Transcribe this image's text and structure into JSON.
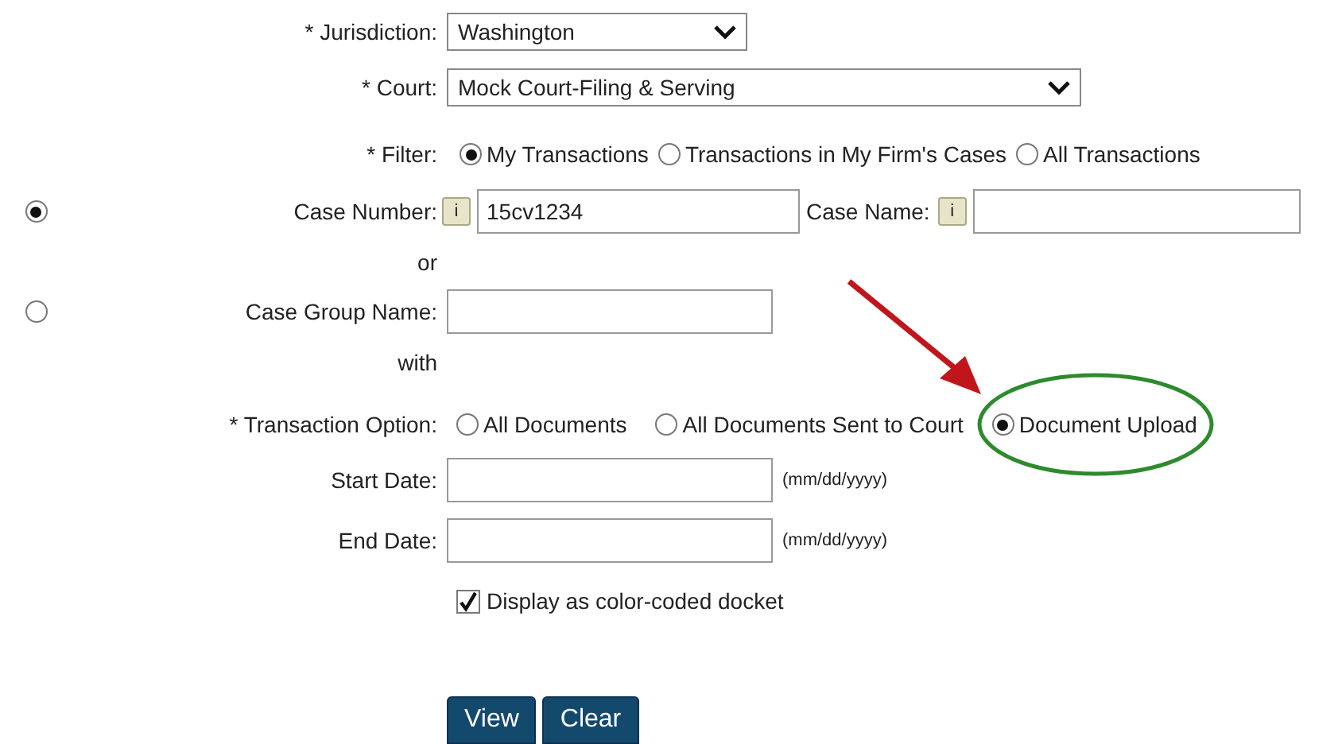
{
  "jurisdiction": {
    "label": "* Jurisdiction:",
    "value": "Washington"
  },
  "court": {
    "label": "* Court:",
    "value": "Mock Court-Filing & Serving"
  },
  "filter": {
    "label": "* Filter:",
    "options": [
      {
        "label": "My Transactions",
        "selected": true
      },
      {
        "label": "Transactions in My Firm's Cases",
        "selected": false
      },
      {
        "label": "All Transactions",
        "selected": false
      }
    ]
  },
  "case_number_row": {
    "selected": true,
    "label": "Case Number:",
    "info": "i",
    "value": "15cv1234",
    "name_label": "Case Name:",
    "name_info": "i"
  },
  "or_text": "or",
  "case_group_row": {
    "selected": false,
    "label": "Case Group Name:"
  },
  "with_text": "with",
  "transaction_option": {
    "label": "* Transaction Option:",
    "options": [
      {
        "label": "All Documents",
        "selected": false
      },
      {
        "label": "All Documents Sent to Court",
        "selected": false
      },
      {
        "label": "Document Upload",
        "selected": true
      }
    ]
  },
  "start_date": {
    "label": "Start Date:",
    "hint": "(mm/dd/yyyy)"
  },
  "end_date": {
    "label": "End Date:",
    "hint": "(mm/dd/yyyy)"
  },
  "color_coded": {
    "label": "Display as color-coded docket",
    "checked": true
  },
  "buttons": [
    "View",
    "Clear"
  ]
}
